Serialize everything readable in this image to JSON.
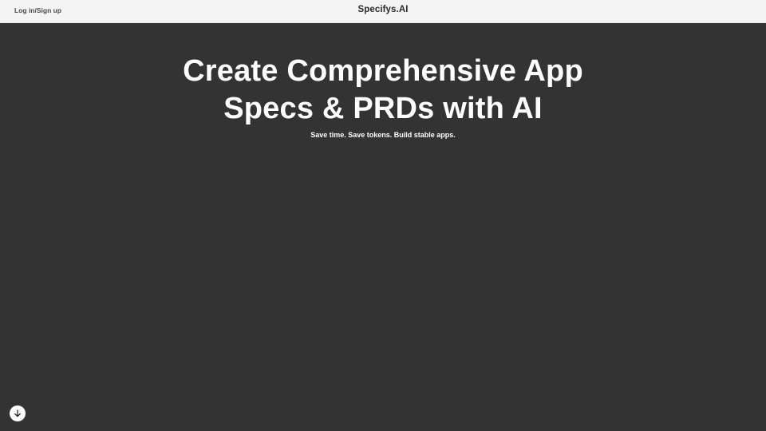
{
  "header": {
    "login_label": "Log in/Sign up",
    "brand": "Specifys.AI"
  },
  "hero": {
    "title": "Create Comprehensive App Specs & PRDs with AI",
    "subtitle": "Save time. Save tokens. Build stable apps."
  },
  "scroll_button": {
    "icon": "arrow-down-icon"
  },
  "colors": {
    "background": "#333333",
    "header_background": "#f4f4f4",
    "text_light": "#ffffff",
    "text_dark": "#2a2a2a"
  }
}
